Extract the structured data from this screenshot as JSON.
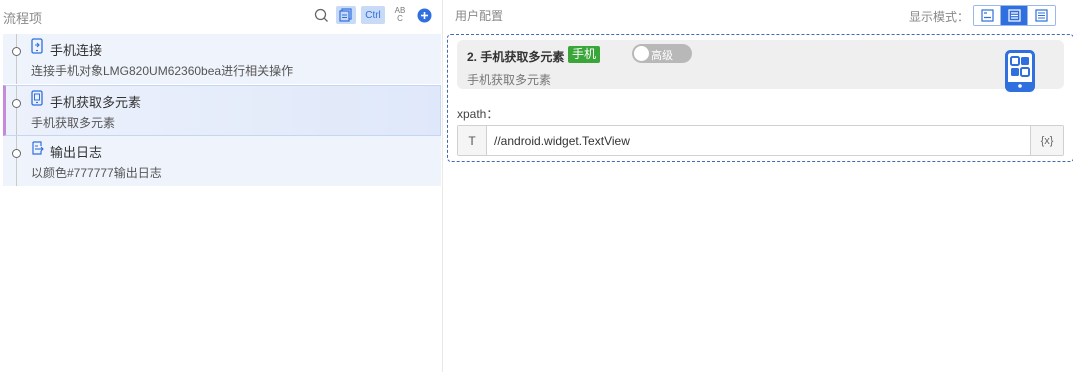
{
  "left_panel": {
    "title": "流程项",
    "toolbar": {
      "ctrl_label": "Ctrl",
      "ab_label_top": "AB",
      "ab_label_bottom": "C"
    },
    "flow_items": [
      {
        "name": "手机连接",
        "desc": "连接手机对象LMG820UM62360bea进行相关操作",
        "icon": "phone-link-icon",
        "selected": false
      },
      {
        "name": "手机获取多元素",
        "desc": "手机获取多元素",
        "icon": "phone-elements-icon",
        "selected": true
      },
      {
        "name": "输出日志",
        "desc": "以颜色#777777输出日志",
        "icon": "log-output-icon",
        "selected": false
      }
    ]
  },
  "right_panel": {
    "title": "用户配置",
    "mode_label": "显示模式：",
    "modes": [
      "mode-compact",
      "mode-card",
      "mode-list"
    ],
    "active_mode": 1,
    "step": {
      "title": "2. 手机获取多元素",
      "tag": "手机",
      "toggle_label": "高级",
      "toggle_on": false,
      "subtitle": "手机获取多元素",
      "icon": "phone-apps-icon"
    },
    "field": {
      "label": "xpath：",
      "prefix": "T",
      "value": "//android.widget.TextView",
      "suffix": "{x}"
    }
  },
  "colors": {
    "accent": "#2f6fde",
    "tag_green": "#3aa63a",
    "selected_marker": "#c58bd9",
    "item_bg": "#eef3fc"
  }
}
